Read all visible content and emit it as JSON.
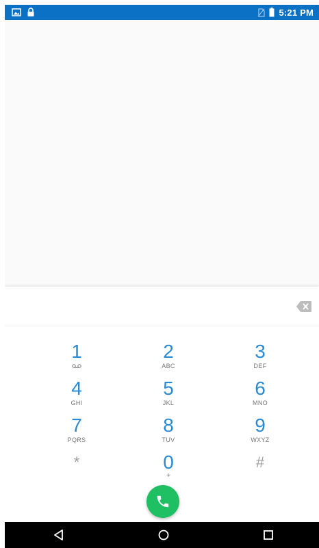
{
  "status_bar": {
    "time": "5:21 PM",
    "left_icons": [
      "image-notification-icon",
      "lock-icon"
    ],
    "right_icons": [
      "no-sim-icon",
      "battery-icon"
    ]
  },
  "dialer": {
    "digits_value": "",
    "keys": [
      {
        "digit": "1",
        "letters": "",
        "sub_icon": "voicemail-icon"
      },
      {
        "digit": "2",
        "letters": "ABC"
      },
      {
        "digit": "3",
        "letters": "DEF"
      },
      {
        "digit": "4",
        "letters": "GHI"
      },
      {
        "digit": "5",
        "letters": "JKL"
      },
      {
        "digit": "6",
        "letters": "MNO"
      },
      {
        "digit": "7",
        "letters": "PQRS"
      },
      {
        "digit": "8",
        "letters": "TUV"
      },
      {
        "digit": "9",
        "letters": "WXYZ"
      },
      {
        "digit": "*",
        "letters": ""
      },
      {
        "digit": "0",
        "letters": "+"
      },
      {
        "digit": "#",
        "letters": ""
      }
    ],
    "call_button_icon": "phone-icon",
    "backspace_icon": "backspace-icon"
  },
  "colors": {
    "status_bar": "#0a71c4",
    "digit": "#2a8bd2",
    "call_button": "#1fbf63",
    "nav_bar": "#000000"
  },
  "nav_bar": {
    "buttons": [
      "back-icon",
      "home-icon",
      "recents-icon"
    ]
  }
}
